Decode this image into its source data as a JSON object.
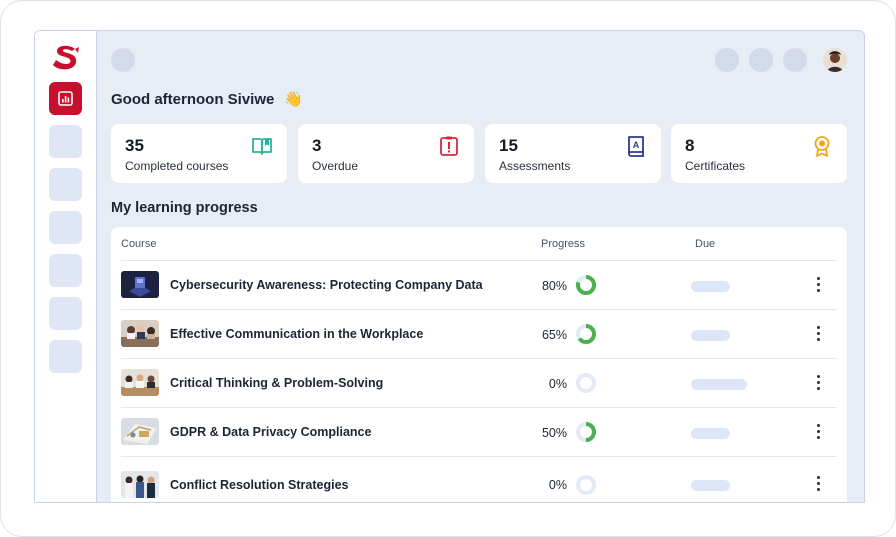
{
  "greeting": {
    "text": "Good afternoon Siviwe",
    "emoji": "👋"
  },
  "stats": [
    {
      "value": "35",
      "label": "Completed courses",
      "icon": "open-book-icon",
      "color": "#2bb39a"
    },
    {
      "value": "3",
      "label": "Overdue",
      "icon": "alert-clipboard-icon",
      "color": "#d62839"
    },
    {
      "value": "15",
      "label": "Assessments",
      "icon": "grade-book-icon",
      "color": "#2d3a8c"
    },
    {
      "value": "8",
      "label": "Certificates",
      "icon": "award-ribbon-icon",
      "color": "#f2a516"
    }
  ],
  "progress": {
    "title": "My learning progress",
    "columns": {
      "course": "Course",
      "progress": "Progress",
      "due": "Due"
    },
    "rows": [
      {
        "course": "Cybersecurity Awareness: Protecting Company Data",
        "percent_label": "80%",
        "percent": 80
      },
      {
        "course": "Effective Communication in the Workplace",
        "percent_label": "65%",
        "percent": 65
      },
      {
        "course": "Critical Thinking & Problem-Solving",
        "percent_label": "0%",
        "percent": 0
      },
      {
        "course": "GDPR & Data Privacy Compliance",
        "percent_label": "50%",
        "percent": 50
      },
      {
        "course": "Conflict Resolution Strategies",
        "percent_label": "0%",
        "percent": 0
      }
    ]
  },
  "colors": {
    "brand": "#c8102e",
    "progress_ring": "#4caf50",
    "ring_track": "#e3eaf7"
  }
}
